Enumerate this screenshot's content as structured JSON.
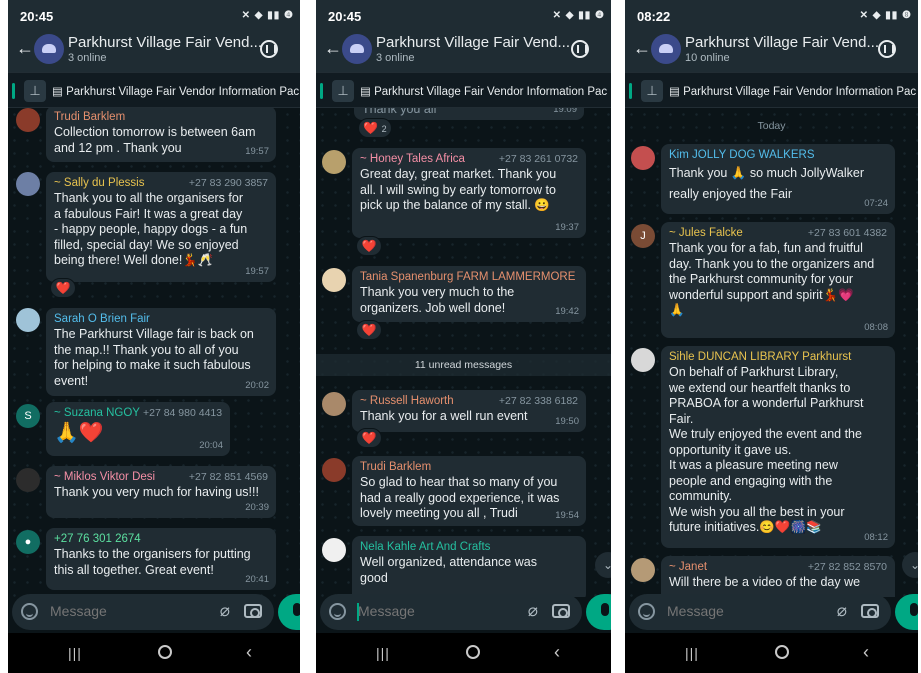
{
  "chat_title": "Parkhurst Village Fair Vend...",
  "pinned_text": "Parkhurst Village Fair Vendor Information Pac",
  "composer_placeholder": "Message",
  "screens": [
    {
      "time": "20:45",
      "online": "3 online",
      "messages": [
        {
          "sender": "Trudi Barklem",
          "sender_color": "#e6906e",
          "phone": "",
          "text": "Collection tomorrow is between 6am\nand 12 pm . Thank you",
          "time": "19:57"
        },
        {
          "sender": "~ Sally du Plessis",
          "sender_color": "#e8c34f",
          "phone": "+27 83 290 3857",
          "text": "Thank you to all the organisers for\na fabulous Fair! It was a great day\n- happy people, happy dogs - a fun\nfilled, special day! We so enjoyed\nbeing there! Well done!💃🥂",
          "time": "19:57",
          "reaction": "❤️"
        },
        {
          "sender": "Sarah O Brien Fair",
          "sender_color": "#53bdeb",
          "phone": "",
          "text": "The Parkhurst Village fair is back on\nthe map.!! Thank you to all of you\nfor helping to make it such fabulous\nevent!",
          "time": "20:02"
        },
        {
          "sender": "~ Suzana NGOY",
          "sender_color": "#25c0a0",
          "phone": "+27 84 980 4413",
          "text": "🙏❤️",
          "time": "20:04",
          "avatar_letter": "S"
        },
        {
          "sender": "~ Miklos Viktor Desi",
          "sender_color": "#f58fa6",
          "phone": "+27 82 851 4569",
          "text": "Thank you very much for having us!!!",
          "time": "20:39"
        },
        {
          "sender": "+27 76 301 2674",
          "sender_color": "#5ce0a0",
          "phone": "",
          "text": "Thanks to the organisers for putting\nthis all together. Great event!",
          "time": "20:41"
        }
      ]
    },
    {
      "time": "20:45",
      "online": "3 online",
      "messages": [
        {
          "sender": "",
          "sender_color": "",
          "phone": "",
          "text": "Thank you all",
          "time": "19:09",
          "reaction": "❤️",
          "reaction_count": "2"
        },
        {
          "sender": "~ Honey Tales Africa",
          "sender_color": "#f58fa6",
          "phone": "+27 83 261 0732",
          "text": "Great day, great market. Thank you\nall. I will swing by early tomorrow to\npick up the balance of my stall. 😀",
          "time": "19:37",
          "reaction": "❤️"
        },
        {
          "sender": "Tania Spanenburg FARM LAMMERMORE",
          "sender_color": "#e6906e",
          "phone": "",
          "text": "Thank you very much to the\norganizers. Job well done!",
          "time": "19:42",
          "reaction": "❤️"
        },
        {
          "sender": "~ Russell Haworth",
          "sender_color": "#e6906e",
          "phone": "+27 82 338 6182",
          "text": "Thank you for a well run event",
          "time": "19:50",
          "reaction": "❤️"
        },
        {
          "sender": "Trudi Barklem",
          "sender_color": "#e6906e",
          "phone": "",
          "text": "So glad to hear that so many of you\nhad a really good experience, it was\nlovely meeting you all , Trudi",
          "time": "19:54"
        },
        {
          "sender": "Nela Kahle Art And Crafts",
          "sender_color": "#25c0a0",
          "phone": "",
          "text": "Well organized,  attendance was\ngood",
          "time": ""
        }
      ],
      "unread_label": "11 unread messages"
    },
    {
      "time": "08:22",
      "online": "10 online",
      "day_label": "Today",
      "messages": [
        {
          "sender": "Kim JOLLY DOG WALKERS",
          "sender_color": "#53bdeb",
          "phone": "",
          "text": "Thank you 🙏 so much JollyWalker\nreally enjoyed the Fair",
          "time": "07:24"
        },
        {
          "sender": "~ Jules Falcke",
          "sender_color": "#e8c34f",
          "phone": "+27 83 601 4382",
          "text": "Thank you for a fab, fun and fruitful\nday. Thank you to the organizers and\nthe Parkhurst community for your\nwonderful support and spirit💃💗\n🙏",
          "time": "08:08",
          "avatar_letter": "J"
        },
        {
          "sender": "Sihle DUNCAN LIBRARY Parkhurst",
          "sender_color": "#e8c34f",
          "phone": "",
          "text": "On behalf of Parkhurst Library,\nwe extend our heartfelt thanks to\nPRABOA for a wonderful Parkhurst\nFair.\nWe truly enjoyed the event and the\nopportunity it gave us.\nIt was a pleasure meeting new\npeople and engaging with the\ncommunity.\nWe wish you all the best in your\nfuture initiatives.😊❤️🎆📚",
          "time": "08:12"
        },
        {
          "sender": "~ Janet",
          "sender_color": "#e6906e",
          "phone": "+27 82 852 8570",
          "text": "Will there be a video of the day we",
          "time": ""
        }
      ]
    }
  ]
}
